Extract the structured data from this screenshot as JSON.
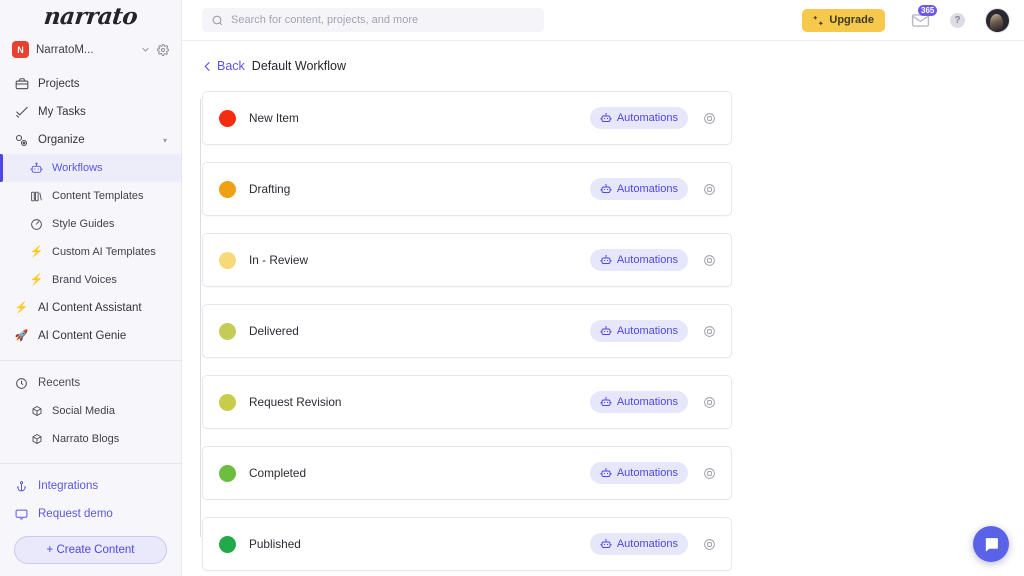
{
  "sidebar": {
    "logo": "narrato",
    "workspace": {
      "initial": "N",
      "name": "NarratoM...",
      "chevron": "chevron-down-icon",
      "gear": "gear-icon"
    },
    "nav": [
      {
        "label": "Projects",
        "icon": "briefcase-icon",
        "active": false
      },
      {
        "label": "My Tasks",
        "icon": "check-icon",
        "active": false
      },
      {
        "label": "Organize",
        "icon": "organize-icon",
        "active": false,
        "caret": "▾"
      }
    ],
    "organize_children": [
      {
        "label": "Workflows",
        "icon": "robot-icon",
        "active": true
      },
      {
        "label": "Content Templates",
        "icon": "templates-icon",
        "active": false
      },
      {
        "label": "Style Guides",
        "icon": "palette-icon",
        "active": false
      },
      {
        "label": "Custom AI Templates",
        "icon": "bolt-icon",
        "emoji": "⚡",
        "active": false
      },
      {
        "label": "Brand Voices",
        "icon": "bolt-icon",
        "emoji": "⚡",
        "active": false
      }
    ],
    "nav_lower": [
      {
        "label": "AI Content Assistant",
        "icon": "bolt-icon",
        "emoji": "⚡"
      },
      {
        "label": "AI Content Genie",
        "icon": "rocket-icon",
        "emoji": "🚀"
      }
    ],
    "recents": {
      "label": "Recents",
      "icon": "clock-icon"
    },
    "recent_items": [
      {
        "label": "Social Media",
        "icon": "box-icon"
      },
      {
        "label": "Narrato Blogs",
        "icon": "box-icon"
      }
    ],
    "bottom_links": [
      {
        "label": "Integrations",
        "icon": "anchor-icon"
      },
      {
        "label": "Request demo",
        "icon": "monitor-icon"
      }
    ],
    "create_button": "+ Create Content"
  },
  "topbar": {
    "search": {
      "placeholder": "Search for content, projects, and more",
      "value": "",
      "icon": "search-icon"
    },
    "upgrade": {
      "label": "Upgrade",
      "icon": "sparkle-icon",
      "color": "#f6c84c"
    },
    "mail": {
      "icon": "mail-icon",
      "badge": "365",
      "badge_color": "#6f5ae8"
    },
    "help": {
      "icon": "help-icon",
      "label": "?"
    },
    "avatar": {
      "icon": "avatar"
    }
  },
  "breadcrumb": {
    "back": "Back",
    "back_icon": "chevron-left-icon",
    "title": "Default Workflow"
  },
  "workflow": {
    "automations_label": "Automations",
    "automations_icon": "robot-icon",
    "settings_icon": "settings-circle-icon",
    "stages": [
      {
        "name": "New Item",
        "color": "#f42c10"
      },
      {
        "name": "Drafting",
        "color": "#f0a013"
      },
      {
        "name": "In - Review",
        "color": "#f7d97a"
      },
      {
        "name": "Delivered",
        "color": "#c4cc57"
      },
      {
        "name": "Request Revision",
        "color": "#c8cc4a"
      },
      {
        "name": "Completed",
        "color": "#6cbe3f"
      },
      {
        "name": "Published",
        "color": "#22a94a"
      }
    ]
  },
  "chat_widget": {
    "icon": "chat-icon",
    "color": "#5a62e8"
  }
}
